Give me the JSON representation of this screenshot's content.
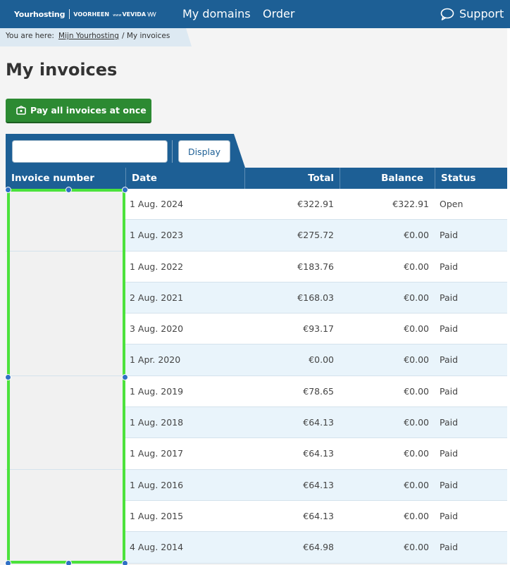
{
  "header": {
    "logo": {
      "brand": "Yourhosting",
      "previously": "VOORHEEN",
      "small": "www",
      "vevida": "VEVIDA",
      "mark": "\\/\\/\\/"
    },
    "nav": [
      "My domains",
      "Order"
    ],
    "support_label": "Support",
    "support_icon": "speech-bubble-icon"
  },
  "breadcrumb": {
    "prefix": "You are here:",
    "link": "Mijn Yourhosting",
    "current": "/ My invoices"
  },
  "page_title": "My invoices",
  "pay_button": {
    "label": "Pay all invoices at once",
    "icon": "wallet-icon"
  },
  "filter": {
    "input_value": "",
    "button_label": "Display"
  },
  "table": {
    "columns": [
      "Invoice number",
      "Date",
      "Total",
      "Balance",
      "Status"
    ],
    "rows": [
      {
        "invoice": "",
        "date": "1 Aug. 2024",
        "total": "€322.91",
        "balance": "€322.91",
        "status": "Open"
      },
      {
        "invoice": "",
        "date": "1 Aug. 2023",
        "total": "€275.72",
        "balance": "€0.00",
        "status": "Paid"
      },
      {
        "invoice": "",
        "date": "1 Aug. 2022",
        "total": "€183.76",
        "balance": "€0.00",
        "status": "Paid"
      },
      {
        "invoice": "",
        "date": "2 Aug. 2021",
        "total": "€168.03",
        "balance": "€0.00",
        "status": "Paid"
      },
      {
        "invoice": "",
        "date": "3 Aug. 2020",
        "total": "€93.17",
        "balance": "€0.00",
        "status": "Paid"
      },
      {
        "invoice": "",
        "date": "1 Apr. 2020",
        "total": "€0.00",
        "balance": "€0.00",
        "status": "Paid"
      },
      {
        "invoice": "",
        "date": "1 Aug. 2019",
        "total": "€78.65",
        "balance": "€0.00",
        "status": "Paid"
      },
      {
        "invoice": "",
        "date": "1 Aug. 2018",
        "total": "€64.13",
        "balance": "€0.00",
        "status": "Paid"
      },
      {
        "invoice": "",
        "date": "1 Aug. 2017",
        "total": "€64.13",
        "balance": "€0.00",
        "status": "Paid"
      },
      {
        "invoice": "",
        "date": "1 Aug. 2016",
        "total": "€64.13",
        "balance": "€0.00",
        "status": "Paid"
      },
      {
        "invoice": "",
        "date": "1 Aug. 2015",
        "total": "€64.13",
        "balance": "€0.00",
        "status": "Paid"
      },
      {
        "invoice": "",
        "date": "4 Aug. 2014",
        "total": "€64.98",
        "balance": "€0.00",
        "status": "Paid"
      }
    ]
  },
  "colors": {
    "primary": "#1d5f95",
    "pay_button": "#2c8a32",
    "row_alt": "#e9f4fb",
    "selection": "#4ce23c",
    "selection_handle": "#2f6fc4"
  }
}
